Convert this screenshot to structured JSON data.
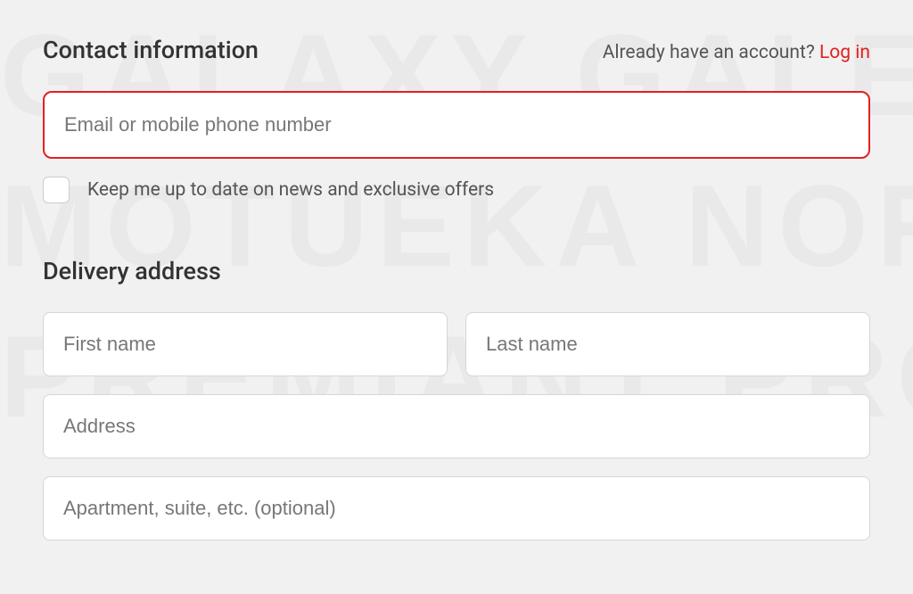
{
  "contact": {
    "heading": "Contact information",
    "account_prompt": "Already have an account? ",
    "login_text": "Log in",
    "email_placeholder": "Email or mobile phone number",
    "newsletter_label": "Keep me up to date on news and exclusive offers"
  },
  "delivery": {
    "heading": "Delivery address",
    "first_name_placeholder": "First name",
    "last_name_placeholder": "Last name",
    "address_placeholder": "Address",
    "apartment_placeholder": "Apartment, suite, etc. (optional)"
  },
  "background": {
    "words": "GALAXY GALENA GLACIER\nMOTUEKA NORTHDOWN NUGGET\nPREMIANT PROGRESS"
  }
}
